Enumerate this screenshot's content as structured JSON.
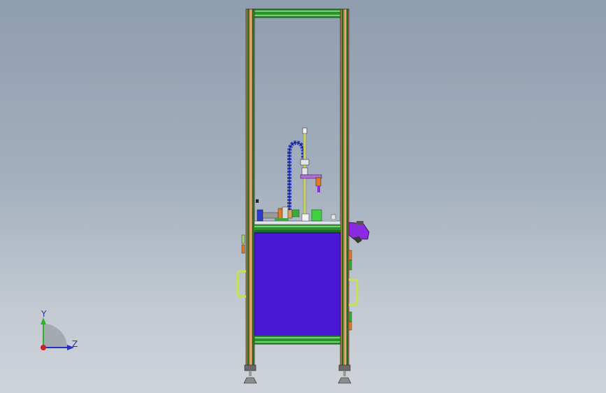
{
  "viewport": {
    "background_top": "#8f9db0",
    "background_bottom": "#cfd4da"
  },
  "model": {
    "frame_color": "#b07f45",
    "frame_rail_color": "#1f6b2a",
    "crossbar_color": "#3aa83a",
    "panel_color": "#4a17d6",
    "handle_color": "#c8e24a",
    "cable_chain_color": "#2d3ccf",
    "cylinder_color": "#8a2be2",
    "accent_orange": "#e07a26"
  },
  "triad": {
    "y_label": "Y",
    "z_label": "Z",
    "y_color": "#2fb12f",
    "z_color": "#2a2fbf",
    "origin_color": "#d21f1f"
  }
}
